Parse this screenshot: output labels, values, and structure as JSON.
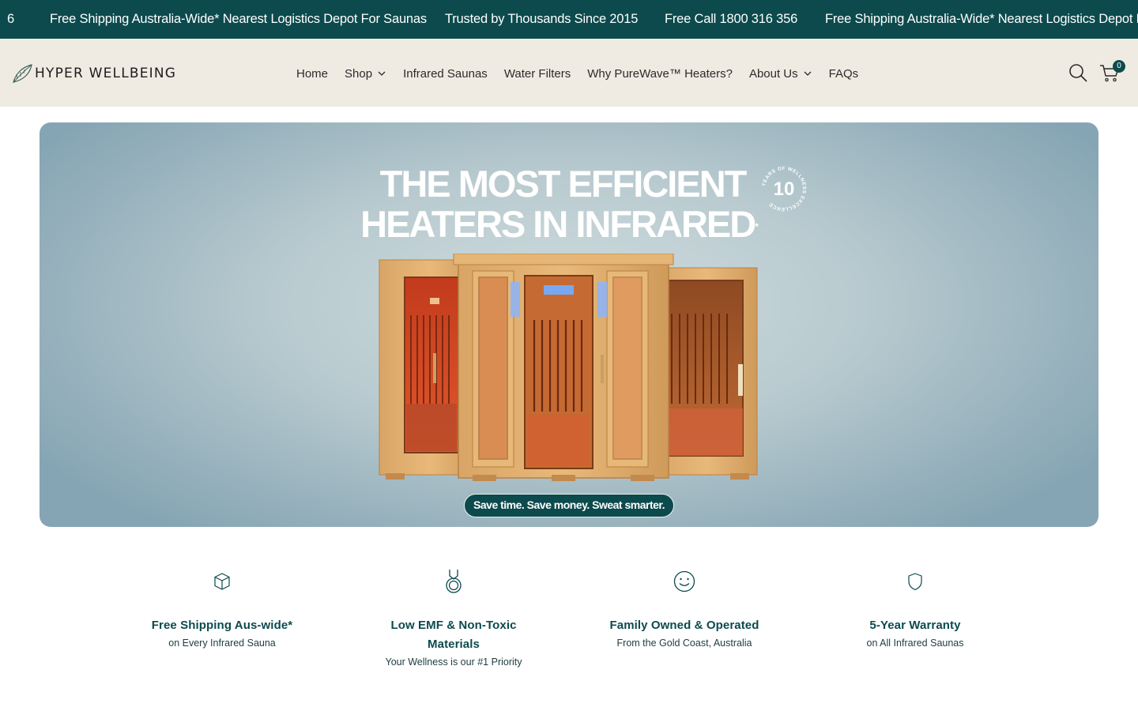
{
  "announcement": {
    "fragment": "6",
    "messages": [
      "Free Shipping Australia-Wide* Nearest Logistics Depot For Saunas",
      "Trusted by Thousands Since 2015",
      "Free Call 1800 316 356",
      "Free Shipping Australia-Wide* Nearest Logistics Depot F"
    ]
  },
  "header": {
    "logo_text": "HYPER WELLBEING",
    "nav": [
      {
        "label": "Home",
        "dropdown": false
      },
      {
        "label": "Shop",
        "dropdown": true
      },
      {
        "label": "Infrared Saunas",
        "dropdown": false
      },
      {
        "label": "Water Filters",
        "dropdown": false
      },
      {
        "label": "Why PureWave™ Heaters?",
        "dropdown": false
      },
      {
        "label": "About Us",
        "dropdown": true
      },
      {
        "label": "FAQs",
        "dropdown": false
      }
    ],
    "search_icon": "search-icon",
    "cart_icon": "cart-icon",
    "cart_count": "0"
  },
  "hero": {
    "title_line1": "THE MOST EFFICIENT",
    "title_line2": "HEATERS IN INFRARED",
    "title_mark": "*",
    "seal_number": "10",
    "seal_text": "YEARS OF WELLNESS EXCELLENCE",
    "tagline": "Save time. Save money. Sweat smarter."
  },
  "features": [
    {
      "icon": "box-icon",
      "title": "Free Shipping Aus-wide*",
      "subtitle": "on Every Infrared Sauna"
    },
    {
      "icon": "medal-icon",
      "title": "Low EMF & Non-Toxic Materials",
      "subtitle": "Your Wellness is our #1 Priority"
    },
    {
      "icon": "smiley-icon",
      "title": "Family Owned & Operated",
      "subtitle": "From the Gold Coast, Australia"
    },
    {
      "icon": "shield-icon",
      "title": "5-Year Warranty",
      "subtitle": "on All Infrared Saunas"
    }
  ],
  "colors": {
    "brand_teal": "#0c4a4d",
    "header_bg": "#efebe3",
    "white": "#ffffff"
  }
}
